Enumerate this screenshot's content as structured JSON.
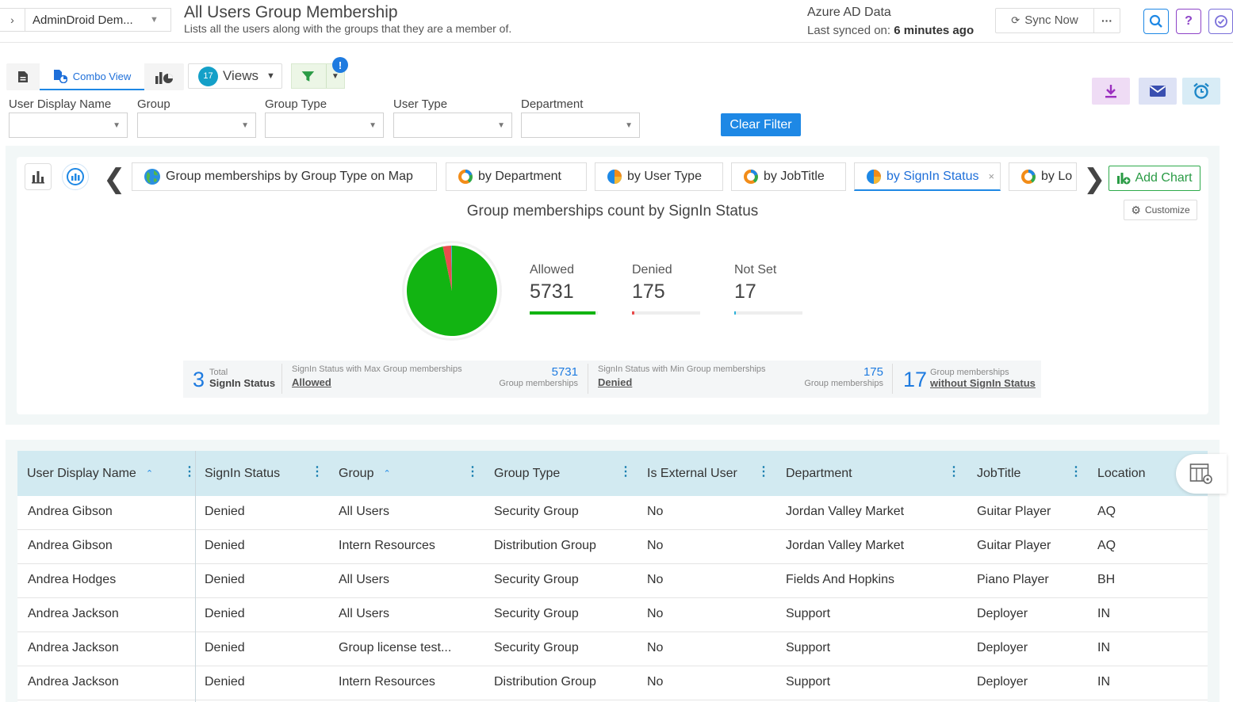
{
  "header": {
    "tenant": "AdminDroid Dem...",
    "title": "All Users Group Membership",
    "subtitle": "Lists all the users along with the groups that they are a member of.",
    "source": "Azure AD Data",
    "synced_label": "Last synced on:",
    "synced_value": "6 minutes ago",
    "sync_button": "Sync Now",
    "more_label": "···",
    "search_icon": "search-icon",
    "help_label": "?",
    "accent": "#1e88e5"
  },
  "toolbar": {
    "view_active": "Combo View",
    "views_count": "17",
    "views_label": "Views",
    "alert_mark": "!"
  },
  "filters": {
    "labels": [
      "User Display Name",
      "Group",
      "Group Type",
      "User Type",
      "Department"
    ],
    "clear_label": "Clear Filter"
  },
  "chart_panel": {
    "tabs": [
      {
        "label": "Group memberships by Group Type on Map",
        "icon": "globe-icon"
      },
      {
        "label": "by Department",
        "icon": "donut-chart-icon"
      },
      {
        "label": "by User Type",
        "icon": "pie-chart-icon"
      },
      {
        "label": "by JobTitle",
        "icon": "donut-chart-icon"
      },
      {
        "label": "by SignIn Status",
        "icon": "pie-chart-icon"
      },
      {
        "label": "by Lo",
        "icon": "donut-chart-icon"
      }
    ],
    "close_label": "×",
    "add_chart": "Add Chart",
    "customize": "Customize",
    "title": "Group memberships count by SignIn Status",
    "summary": {
      "total_value": "3",
      "total_small": "Total",
      "total_label": "SignIn Status",
      "max_caption": "SignIn Status with Max Group memberships",
      "max_link": "Allowed",
      "max_value": "5731",
      "max_unit": "Group memberships",
      "min_caption": "SignIn Status with Min Group memberships",
      "min_link": "Denied",
      "min_value": "175",
      "min_unit": "Group memberships",
      "without_value": "17",
      "without_caption": "Group memberships",
      "without_link": "without SignIn Status"
    }
  },
  "chart_data": {
    "type": "pie",
    "title": "Group memberships count by SignIn Status",
    "categories": [
      "Allowed",
      "Denied",
      "Not Set"
    ],
    "values": [
      5731,
      175,
      17
    ],
    "colors": [
      "#12b412",
      "#e84d4d",
      "#2eb2d9"
    ],
    "legend": "right"
  },
  "table": {
    "columns": [
      {
        "label": "User Display Name",
        "sorted": true
      },
      {
        "label": "SignIn Status",
        "sorted": false
      },
      {
        "label": "Group",
        "sorted": true
      },
      {
        "label": "Group Type",
        "sorted": false
      },
      {
        "label": "Is External User",
        "sorted": false
      },
      {
        "label": "Department",
        "sorted": false
      },
      {
        "label": "JobTitle",
        "sorted": false
      },
      {
        "label": "Location",
        "sorted": false
      }
    ],
    "rows": [
      [
        "Andrea Gibson",
        "Denied",
        "All Users",
        "Security Group",
        "No",
        "Jordan Valley Market",
        "Guitar Player",
        "AQ"
      ],
      [
        "Andrea Gibson",
        "Denied",
        "Intern Resources",
        "Distribution Group",
        "No",
        "Jordan Valley Market",
        "Guitar Player",
        "AQ"
      ],
      [
        "Andrea Hodges",
        "Denied",
        "All Users",
        "Security Group",
        "No",
        "Fields And Hopkins",
        "Piano Player",
        "BH"
      ],
      [
        "Andrea Jackson",
        "Denied",
        "All Users",
        "Security Group",
        "No",
        "Support",
        "Deployer",
        "IN"
      ],
      [
        "Andrea Jackson",
        "Denied",
        "Group license test...",
        "Security Group",
        "No",
        "Support",
        "Deployer",
        "IN"
      ],
      [
        "Andrea Jackson",
        "Denied",
        "Intern Resources",
        "Distribution Group",
        "No",
        "Support",
        "Deployer",
        "IN"
      ]
    ]
  }
}
